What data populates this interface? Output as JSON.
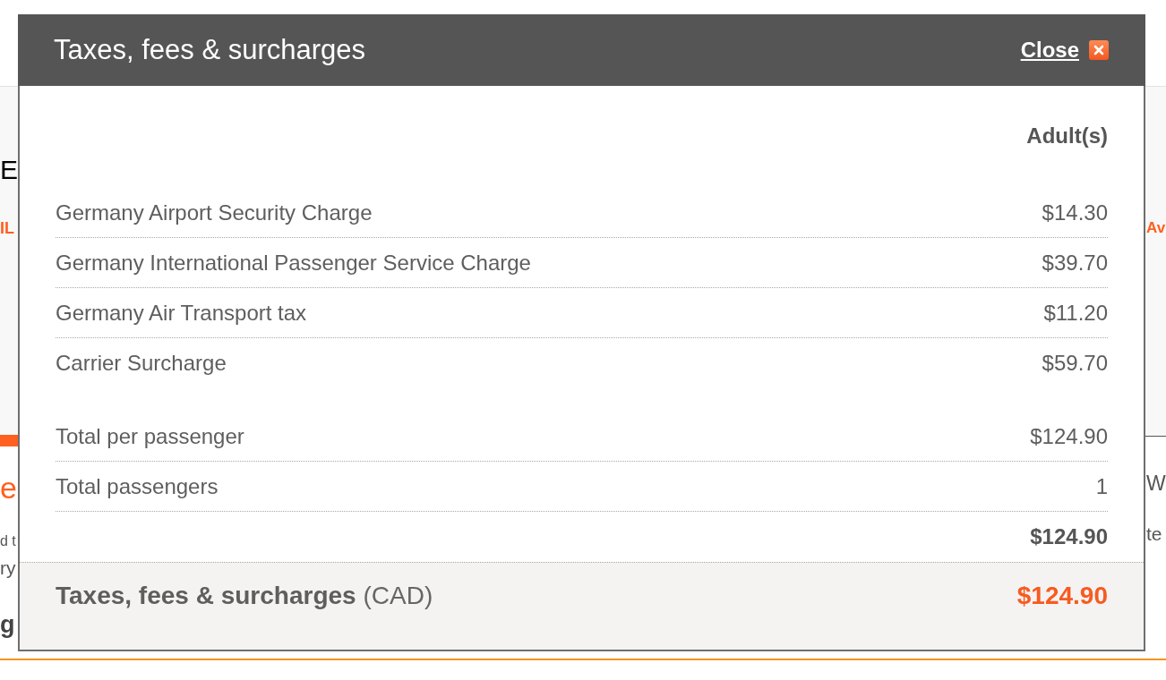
{
  "background_page": {
    "left_column": {
      "heading": "E",
      "link": "IL",
      "section_heading": "e",
      "text_lines": [
        "d t",
        "ry"
      ],
      "bold_text": "g"
    },
    "right_column": {
      "link": "Av",
      "section_heading": "W",
      "text_line": "te"
    }
  },
  "dialog": {
    "title": "Taxes, fees & surcharges",
    "close_label": "Close",
    "column_header": "Adult(s)",
    "charges": [
      {
        "label": "Germany Airport Security Charge",
        "amount": "$14.30"
      },
      {
        "label": "Germany International Passenger Service Charge",
        "amount": "$39.70"
      },
      {
        "label": "Germany Air Transport tax",
        "amount": "$11.20"
      },
      {
        "label": "Carrier Surcharge",
        "amount": "$59.70"
      }
    ],
    "totals": [
      {
        "label": "Total per passenger",
        "amount": "$124.90"
      },
      {
        "label": "Total passengers",
        "amount": "1"
      }
    ],
    "subtotal": "$124.90",
    "footer": {
      "label": "**Taxes, fees & surcharges** (CAD)",
      "amount": "$124.90"
    }
  }
}
